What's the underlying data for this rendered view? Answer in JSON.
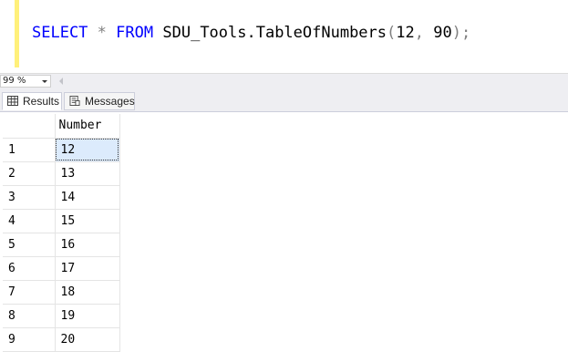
{
  "editor": {
    "tokens": {
      "select": "SELECT",
      "star": "*",
      "from": "FROM",
      "object": "SDU_Tools.TableOfNumbers",
      "open_paren": "(",
      "arg1": "12",
      "comma": ",",
      "arg2": "90",
      "close_paren": ")",
      "semicolon": ";"
    }
  },
  "zoom": {
    "value": "99 %"
  },
  "tabs": {
    "results_label": "Results",
    "messages_label": "Messages"
  },
  "grid": {
    "columns": [
      "Number"
    ],
    "rows": [
      {
        "rownum": "1",
        "number": "12"
      },
      {
        "rownum": "2",
        "number": "13"
      },
      {
        "rownum": "3",
        "number": "14"
      },
      {
        "rownum": "4",
        "number": "15"
      },
      {
        "rownum": "5",
        "number": "16"
      },
      {
        "rownum": "6",
        "number": "17"
      },
      {
        "rownum": "7",
        "number": "18"
      },
      {
        "rownum": "8",
        "number": "19"
      },
      {
        "rownum": "9",
        "number": "20"
      }
    ]
  },
  "colors": {
    "keyword": "#0000ff",
    "operator": "#808080",
    "margin_bar": "#fff07a",
    "selected_cell": "#dcebfc"
  }
}
